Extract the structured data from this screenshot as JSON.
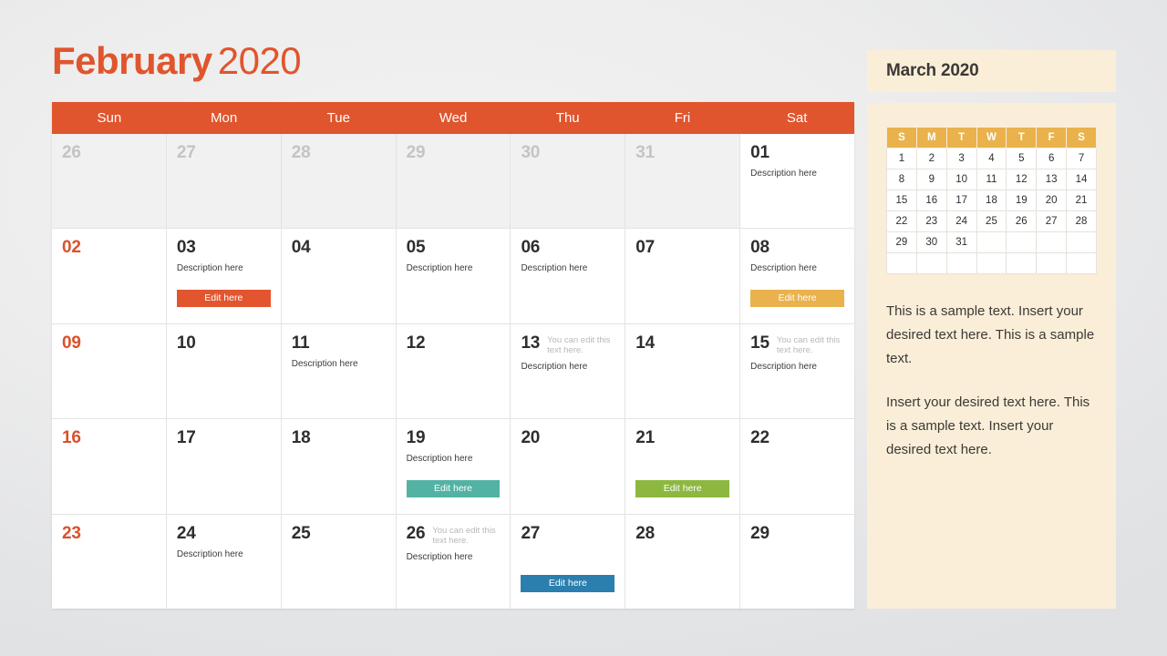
{
  "header": {
    "month_name": "February",
    "year": "2020"
  },
  "calendar": {
    "weekday_labels": [
      "Sun",
      "Mon",
      "Tue",
      "Wed",
      "Thu",
      "Fri",
      "Sat"
    ],
    "header_bg": "#e0552d",
    "sunday_color": "#d9512c",
    "weeks": [
      [
        {
          "day": "26",
          "outside": true
        },
        {
          "day": "27",
          "outside": true
        },
        {
          "day": "28",
          "outside": true
        },
        {
          "day": "29",
          "outside": true
        },
        {
          "day": "30",
          "outside": true
        },
        {
          "day": "31",
          "outside": true
        },
        {
          "day": "01",
          "desc": "Description here"
        }
      ],
      [
        {
          "day": "02",
          "sunday": true
        },
        {
          "day": "03",
          "desc": "Description here",
          "button": {
            "label": "Edit here",
            "color": "#e2552f"
          }
        },
        {
          "day": "04"
        },
        {
          "day": "05",
          "desc": "Description here"
        },
        {
          "day": "06",
          "desc": "Description here"
        },
        {
          "day": "07"
        },
        {
          "day": "08",
          "desc": "Description here",
          "button": {
            "label": "Edit here",
            "color": "#e9b24c"
          }
        }
      ],
      [
        {
          "day": "09",
          "sunday": true
        },
        {
          "day": "10"
        },
        {
          "day": "11",
          "desc": "Description here"
        },
        {
          "day": "12"
        },
        {
          "day": "13",
          "note": "You can edit this text here.",
          "desc": "Description here"
        },
        {
          "day": "14"
        },
        {
          "day": "15",
          "note": "You can edit this text here.",
          "desc": "Description here"
        }
      ],
      [
        {
          "day": "16",
          "sunday": true
        },
        {
          "day": "17"
        },
        {
          "day": "18"
        },
        {
          "day": "19",
          "desc": "Description here",
          "button": {
            "label": "Edit here",
            "color": "#52b3a4"
          }
        },
        {
          "day": "20"
        },
        {
          "day": "21",
          "button": {
            "label": "Edit here",
            "color": "#8cb83f"
          }
        },
        {
          "day": "22"
        }
      ],
      [
        {
          "day": "23",
          "sunday": true
        },
        {
          "day": "24",
          "desc": "Description here"
        },
        {
          "day": "25"
        },
        {
          "day": "26",
          "note": "You can edit this text here.",
          "desc": "Description here"
        },
        {
          "day": "27",
          "button": {
            "label": "Edit here",
            "color": "#2a7fae"
          }
        },
        {
          "day": "28"
        },
        {
          "day": "29"
        }
      ]
    ]
  },
  "sidebar": {
    "title": "March 2020",
    "mini_calendar": {
      "weekday_labels": [
        "S",
        "M",
        "T",
        "W",
        "T",
        "F",
        "S"
      ],
      "header_bg": "#e9b24c",
      "weeks": [
        [
          "1",
          "2",
          "3",
          "4",
          "5",
          "6",
          "7"
        ],
        [
          "8",
          "9",
          "10",
          "11",
          "12",
          "13",
          "14"
        ],
        [
          "15",
          "16",
          "17",
          "18",
          "19",
          "20",
          "21"
        ],
        [
          "22",
          "23",
          "24",
          "25",
          "26",
          "27",
          "28"
        ],
        [
          "29",
          "30",
          "31",
          "",
          "",
          "",
          ""
        ],
        [
          "",
          "",
          "",
          "",
          "",
          "",
          ""
        ]
      ]
    },
    "paragraphs": [
      "This is a sample text. Insert your desired text here. This is a sample text.",
      "Insert your desired text here. This is a sample text. Insert your desired text here."
    ],
    "panel_bg": "#faeed8"
  }
}
